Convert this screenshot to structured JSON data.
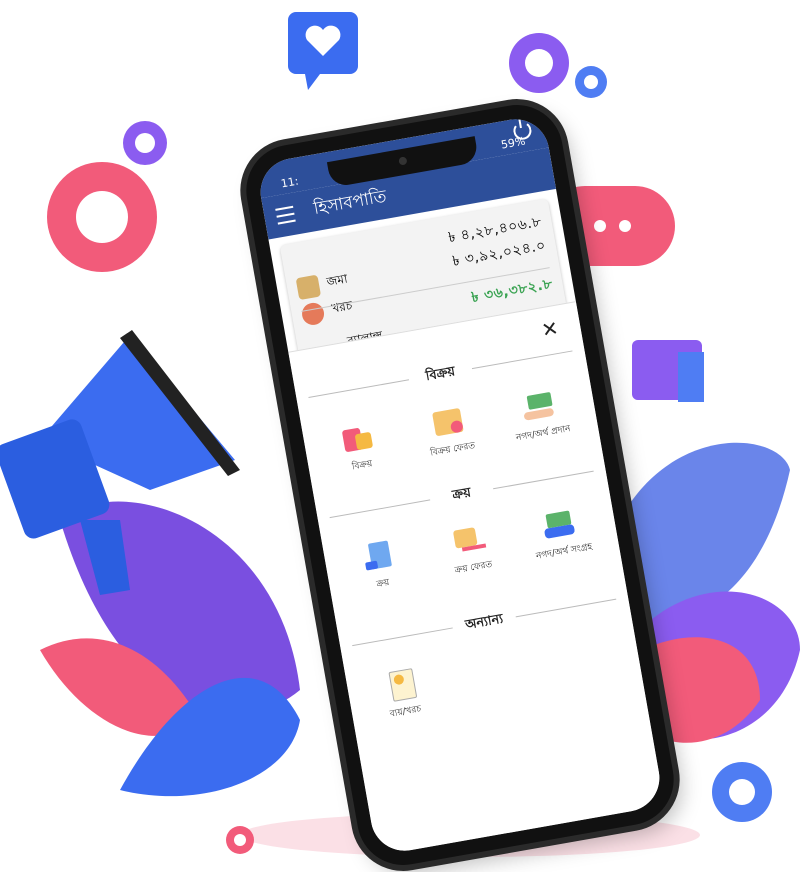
{
  "status_bar": {
    "time": "11:",
    "battery": "59%"
  },
  "app_bar": {
    "title": "হিসাবপাতি"
  },
  "summary": {
    "total_amount": "৳ ৪,২৮,৪০৬.৮",
    "deposit_label": "জমা",
    "expense_label": "খরচ",
    "expense_amount": "৳ ৩,৯২,০২৪.০",
    "balance_label": "ব্যালান্স",
    "balance_amount": "৳ ৩৬,৩৮২.৮"
  },
  "sheet": {
    "close_label": "✕",
    "sections": [
      {
        "title": "বিক্রয়",
        "items": [
          {
            "label": "বিক্রয়",
            "icon": "shopping-bags-icon"
          },
          {
            "label": "বিক্রয় ফেরত",
            "icon": "return-box-icon"
          },
          {
            "label": "নগদ/অর্থ প্রদান",
            "icon": "cash-give-icon"
          }
        ]
      },
      {
        "title": "ক্রয়",
        "items": [
          {
            "label": "ক্রয়",
            "icon": "purchase-doc-icon"
          },
          {
            "label": "ক্রয় ফেরত",
            "icon": "return-arrow-box-icon"
          },
          {
            "label": "নগদ/অর্থ সংগ্রহ",
            "icon": "cash-receive-icon"
          }
        ]
      },
      {
        "title": "অন্যান্য",
        "items": [
          {
            "label": "ব্যয়/খরচ",
            "icon": "expense-bill-icon"
          }
        ]
      }
    ]
  },
  "colors": {
    "primary": "#2d4f9a",
    "green": "#3aa352",
    "pink": "#f25b7a",
    "purple": "#7a4fe0",
    "blue": "#3b6cf0"
  }
}
